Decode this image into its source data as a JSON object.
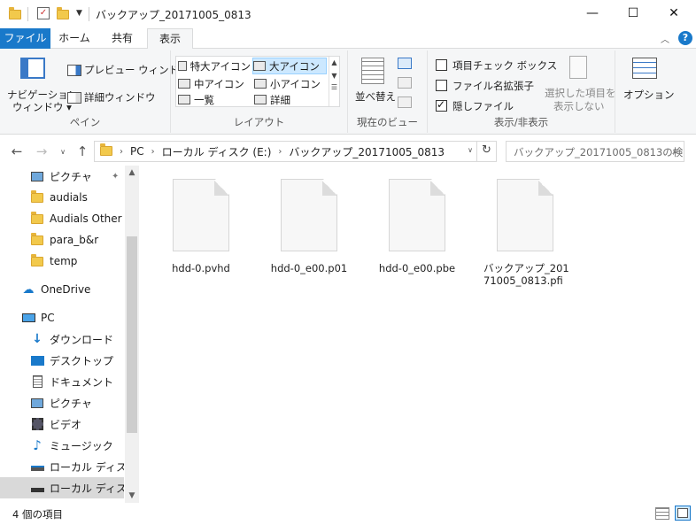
{
  "window": {
    "title": "バックアップ_20171005_0813",
    "minimize": "—",
    "maximize": "☐",
    "close": "✕"
  },
  "ribbon_tabs": [
    {
      "label": "ファイル"
    },
    {
      "label": "ホーム"
    },
    {
      "label": "共有"
    },
    {
      "label": "表示"
    }
  ],
  "help": "?",
  "ribbon": {
    "pane": {
      "nav_window": "ナビゲーション",
      "nav_window2": "ウィンドウ",
      "preview": "プレビュー ウィンドウ",
      "details": "詳細ウィンドウ",
      "label": "ペイン"
    },
    "layout": {
      "items": [
        "特大アイコン",
        "大アイコン",
        "中アイコン",
        "小アイコン",
        "一覧",
        "詳細"
      ],
      "label": "レイアウト"
    },
    "current_view": {
      "sort": "並べ替え",
      "label": "現在のビュー"
    },
    "show_hide": {
      "item_checkbox": "項目チェック ボックス",
      "extensions": "ファイル名拡張子",
      "hidden": "隠しファイル",
      "hide_selected1": "選択した項目を",
      "hide_selected2": "表示しない",
      "label": "表示/非表示"
    },
    "options": "オプション"
  },
  "address": {
    "crumbs": [
      "PC",
      "ローカル ディスク (E:)",
      "バックアップ_20171005_0813"
    ],
    "search_placeholder": "バックアップ_20171005_0813の検..."
  },
  "nav_pane": [
    {
      "label": "ピクチャ",
      "icon": "pictures-icon"
    },
    {
      "label": "audials",
      "icon": "folder-icon"
    },
    {
      "label": "Audials Other Vi",
      "icon": "folder-icon"
    },
    {
      "label": "para_b&r",
      "icon": "folder-icon"
    },
    {
      "label": "temp",
      "icon": "folder-icon"
    },
    {
      "label": "OneDrive",
      "icon": "cloud-icon"
    },
    {
      "label": "PC",
      "icon": "pc-icon"
    },
    {
      "label": "ダウンロード",
      "icon": "download-icon"
    },
    {
      "label": "デスクトップ",
      "icon": "desktop-icon"
    },
    {
      "label": "ドキュメント",
      "icon": "document-icon"
    },
    {
      "label": "ピクチャ",
      "icon": "pictures-icon"
    },
    {
      "label": "ビデオ",
      "icon": "video-icon"
    },
    {
      "label": "ミュージック",
      "icon": "music-icon"
    },
    {
      "label": "ローカル ディスク (C",
      "icon": "drive-icon"
    },
    {
      "label": "ローカル ディスク (E",
      "icon": "drive-icon"
    }
  ],
  "files": [
    {
      "name": "hdd-0.pvhd"
    },
    {
      "name": "hdd-0_e00.p01"
    },
    {
      "name": "hdd-0_e00.pbe"
    },
    {
      "name": "バックアップ_20171005_0813.pfi"
    }
  ],
  "status": {
    "count": "4 個の項目"
  }
}
